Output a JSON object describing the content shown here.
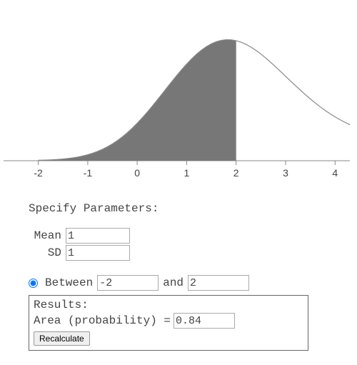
{
  "chart_data": {
    "type": "area",
    "title": "",
    "distribution": "normal",
    "mean": 1,
    "sd": 1,
    "shaded_range": [
      -2,
      2
    ],
    "x_ticks": [
      -2,
      -1,
      0,
      1,
      2,
      3,
      4
    ],
    "xlim": [
      -2.5,
      4.5
    ],
    "ylabel": "",
    "xlabel": ""
  },
  "form": {
    "title": "Specify Parameters:",
    "mean_label": "Mean",
    "mean_value": "1",
    "sd_label": "SD",
    "sd_value": "1",
    "between_label": "Between",
    "between_lo": "-2",
    "between_and": "and",
    "between_hi": "2",
    "results_title": "Results:",
    "area_label": "Area (probability) =",
    "area_value": "0.84",
    "recalc": "Recalculate"
  }
}
